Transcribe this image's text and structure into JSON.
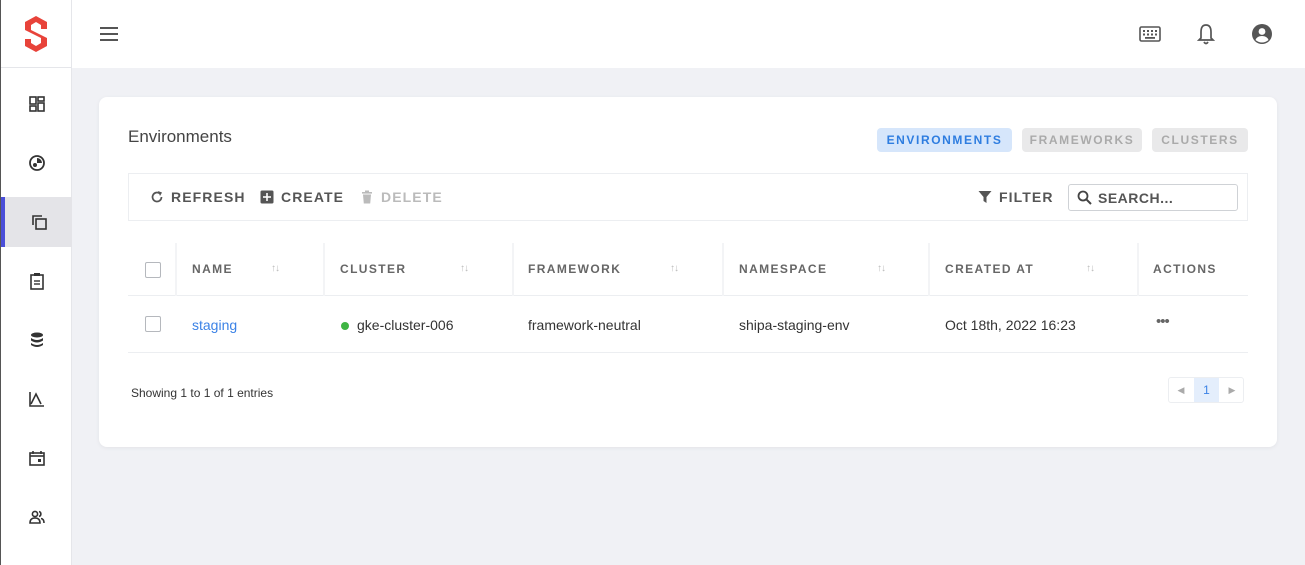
{
  "sidebar": {
    "items": [
      {
        "icon": "dashboard-icon"
      },
      {
        "icon": "apps-icon"
      },
      {
        "icon": "environments-icon",
        "active": true
      },
      {
        "icon": "clipboard-icon"
      },
      {
        "icon": "database-icon"
      },
      {
        "icon": "chart-icon"
      },
      {
        "icon": "calendar-icon"
      },
      {
        "icon": "users-icon"
      }
    ]
  },
  "topbar": {
    "icons": [
      "menu-icon",
      "keyboard-icon",
      "bell-icon",
      "account-icon"
    ]
  },
  "page": {
    "title": "Environments",
    "tabs": [
      {
        "label": "ENVIRONMENTS",
        "active": true
      },
      {
        "label": "FRAMEWORKS",
        "active": false
      },
      {
        "label": "CLUSTERS",
        "active": false
      }
    ]
  },
  "toolbar": {
    "refresh_label": "REFRESH",
    "create_label": "CREATE",
    "delete_label": "DELETE",
    "filter_label": "FILTER",
    "search_placeholder": "SEARCH..."
  },
  "table": {
    "columns": [
      "NAME",
      "CLUSTER",
      "FRAMEWORK",
      "NAMESPACE",
      "CREATED AT",
      "ACTIONS"
    ],
    "rows": [
      {
        "name": "staging",
        "cluster": "gke-cluster-006",
        "cluster_status_color": "#3fb543",
        "framework": "framework-neutral",
        "namespace": "shipa-staging-env",
        "created_at": "Oct 18th, 2022 16:23",
        "actions": "•••"
      }
    ]
  },
  "footer": {
    "showing": "Showing 1 to 1 of 1 entries",
    "current_page": "1"
  },
  "colors": {
    "accent": "#4a4ed8",
    "brand": "#e8433a",
    "link": "#3b82e6"
  }
}
